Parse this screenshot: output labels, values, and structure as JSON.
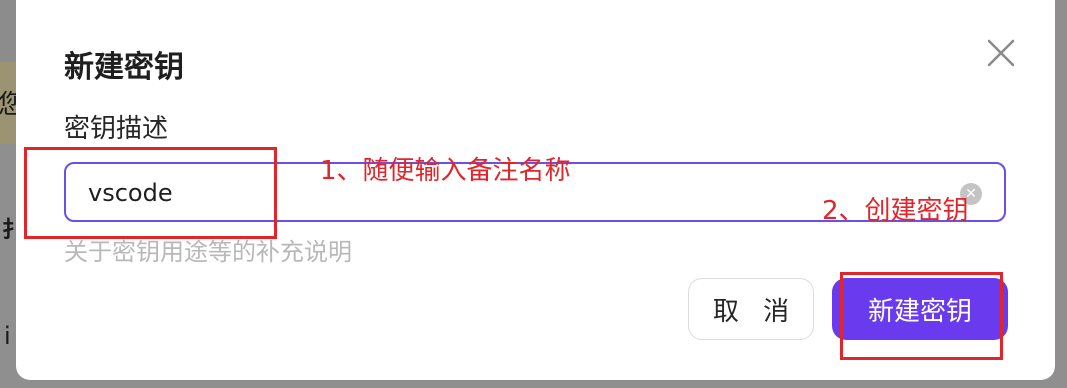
{
  "background": {
    "partial_chars": [
      "您",
      "i",
      "扌"
    ]
  },
  "dialog": {
    "title": "新建密钥",
    "field_label": "密钥描述",
    "input_value": "vscode",
    "hint": "关于密钥用途等的补充说明",
    "cancel_label": "取 消",
    "create_label": "新建密钥"
  },
  "annotations": {
    "step1": "1、随便输入备注名称",
    "step2": "2、创建密钥"
  },
  "colors": {
    "accent": "#6a3bee",
    "annotation": "#e0262b"
  }
}
